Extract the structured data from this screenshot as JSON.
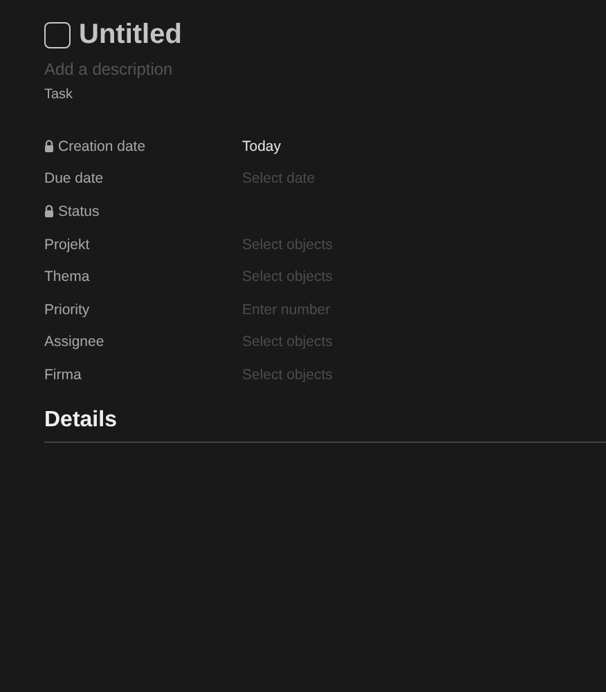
{
  "title": "Untitled",
  "title_checked": false,
  "description": {
    "placeholder": "Add a description"
  },
  "type": "Task",
  "properties": [
    {
      "label": "Creation date",
      "locked": true,
      "kind": "value",
      "text": "Today"
    },
    {
      "label": "Due date",
      "locked": false,
      "kind": "placeholder",
      "text": "Select date"
    },
    {
      "label": "Status",
      "locked": true,
      "kind": "empty"
    },
    {
      "label": "Projekt",
      "locked": false,
      "kind": "placeholder",
      "text": "Select objects"
    },
    {
      "label": "Thema",
      "locked": false,
      "kind": "placeholder",
      "text": "Select objects"
    },
    {
      "label": "Priority",
      "locked": false,
      "kind": "placeholder",
      "text": "Enter number"
    },
    {
      "label": "Assignee",
      "locked": false,
      "kind": "placeholder",
      "text": "Select objects"
    },
    {
      "label": "Firma",
      "locked": false,
      "kind": "placeholder",
      "text": "Select objects"
    }
  ],
  "section": "Details"
}
